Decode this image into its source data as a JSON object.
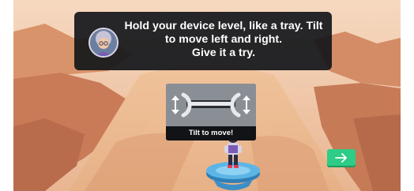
{
  "dialog": {
    "lines": [
      "Hold your device level, like a tray. Tilt",
      "to move left and right.",
      "Give it a try."
    ],
    "avatar_icon": "character-portrait"
  },
  "tilt_card": {
    "label": "Tilt to move!",
    "icons": [
      "up-down-arrow-icon",
      "tablet-hands-icon",
      "up-down-arrow-icon"
    ]
  },
  "next_button": {
    "icon": "arrow-right-icon",
    "color": "#2ecc86"
  },
  "colors": {
    "sky": "#f2c4a0",
    "sand": "#e8a77a",
    "dialog_bg": "#14161a",
    "platform": "#4aa3d8"
  }
}
